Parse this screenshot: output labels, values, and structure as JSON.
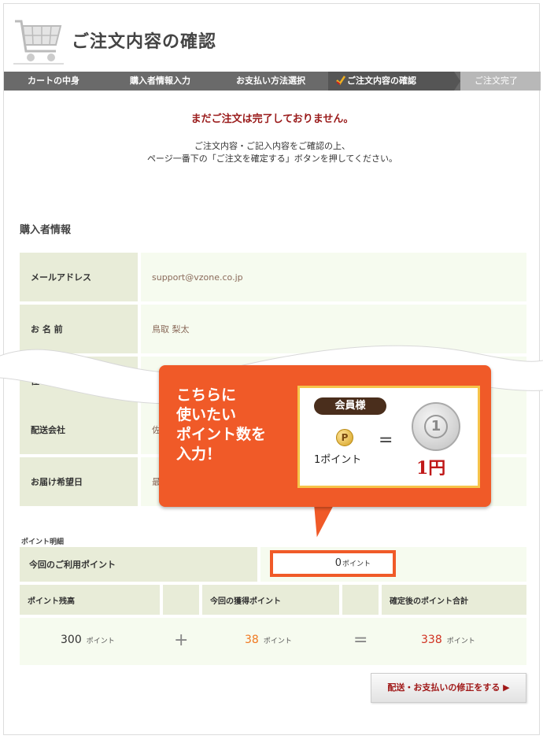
{
  "header": {
    "title": "ご注文内容の確認"
  },
  "steps": [
    {
      "label": "カートの中身"
    },
    {
      "label": "購入者情報入力"
    },
    {
      "label": "お支払い方法選択"
    },
    {
      "label": "ご注文内容の確認"
    },
    {
      "label": "ご注文完了"
    }
  ],
  "notice": {
    "title": "まだご注文は完了しておりません。",
    "line1": "ご注文内容・ご記入内容をご確認の上、",
    "line2": "ページ一番下の「ご注文を確定する」ボタンを押してください。"
  },
  "buyer": {
    "section_title": "購入者情報",
    "rows": [
      {
        "label": "メールアドレス",
        "value": "support@vzone.co.jp"
      },
      {
        "label": "お 名 前",
        "value": "鳥取 梨太"
      },
      {
        "label": "住",
        "value": ""
      },
      {
        "label": "配送会社",
        "value": "佐"
      },
      {
        "label": "お届け希望日",
        "value": "最"
      }
    ]
  },
  "points": {
    "caption": "ポイント明細",
    "use_label": "今回のご利用ポイント",
    "use_value": "0",
    "unit": "ポイント",
    "headers": [
      "ポイント残高",
      "今回の獲得ポイント",
      "確定後のポイント合計"
    ],
    "balance": "300",
    "earned": "38",
    "total": "338",
    "plus": "+",
    "equals": "="
  },
  "fix_button": {
    "label": "配送・お支払いの修正をする ▶"
  },
  "callout": {
    "line1": "こちらに",
    "line2": "使いたい",
    "line3": "ポイント数を",
    "line4": "入力！",
    "member_badge": "会員様",
    "coin_letter": "P",
    "one_point": "1ポイント",
    "equals": "=",
    "yen_coin": "1",
    "one_yen": "1円"
  },
  "colors": {
    "accent": "#f05a28",
    "notice_red": "#9a1b1b",
    "label_bg": "#e8ecd8",
    "value_bg": "#f6fbef",
    "step_bar": "#6a6a6a"
  }
}
